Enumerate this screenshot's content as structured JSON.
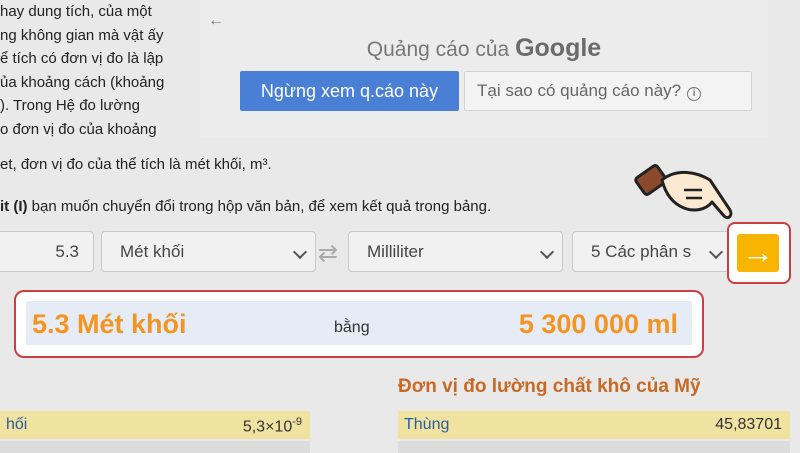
{
  "intro": {
    "lines": [
      "hay dung tích, của một",
      "ng không gian mà vật ấy",
      "ể tích có đơn vị đo là lập",
      "ủa khoảng cách (khoảng",
      "). Trong Hệ đo lường",
      "o đơn vị đo của khoảng"
    ],
    "wide_line": "et, đơn vị đo của thể tích là mét khối, m³.",
    "instruction_bold": "it (I)",
    "instruction_rest": " bạn muốn chuyển đổi trong hộp văn bản, để xem kết quả trong bảng."
  },
  "ad": {
    "back_glyph": "←",
    "title_prefix": "Quảng cáo của ",
    "title_brand": "Google",
    "stop_label": "Ngừng xem q.cáo này",
    "why_label": "Tại sao có quảng cáo này?",
    "info_glyph": "i"
  },
  "converter": {
    "value": "5.3",
    "from_unit": "Mét khối",
    "to_unit": "Milliliter",
    "precision": "5 Các phân s",
    "swap_glyph": "⇄",
    "go_glyph": "→"
  },
  "result": {
    "left": "5.3 Mét khối",
    "mid": "bằng",
    "right": "5 300 000 ml"
  },
  "table_left": {
    "row1_key": "hối",
    "row1_val": "5,3×10",
    "row1_exp": "-9"
  },
  "table_right": {
    "title": "Đơn vị đo lường chất khô của Mỹ",
    "row1_key": "Thùng",
    "row1_val": "45,83701"
  },
  "colors": {
    "accent_orange": "#f39423",
    "highlight_red": "#c94040",
    "go_yellow": "#f7b500",
    "ad_blue": "#4a7fd6"
  }
}
